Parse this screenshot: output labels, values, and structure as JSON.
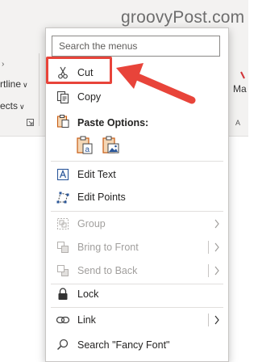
{
  "watermark": "groovyPost.com",
  "ribbon": {
    "outline_label": "rtline",
    "effects_label": "ects",
    "right_label": "Ma",
    "right_small": "A"
  },
  "menu": {
    "search_placeholder": "Search the menus",
    "items": {
      "cut": "Cut",
      "copy": "Copy",
      "paste_options": "Paste Options:",
      "edit_text": "Edit Text",
      "edit_points": "Edit Points",
      "group": "Group",
      "bring_to_front": "Bring to Front",
      "send_to_back": "Send to Back",
      "lock": "Lock",
      "link": "Link",
      "search": "Search \"Fancy Font\""
    }
  },
  "colors": {
    "callout": "#e8443a",
    "accent_blue": "#2b579a",
    "disabled": "#a19f9d",
    "paste_orange": "#c75b12"
  }
}
